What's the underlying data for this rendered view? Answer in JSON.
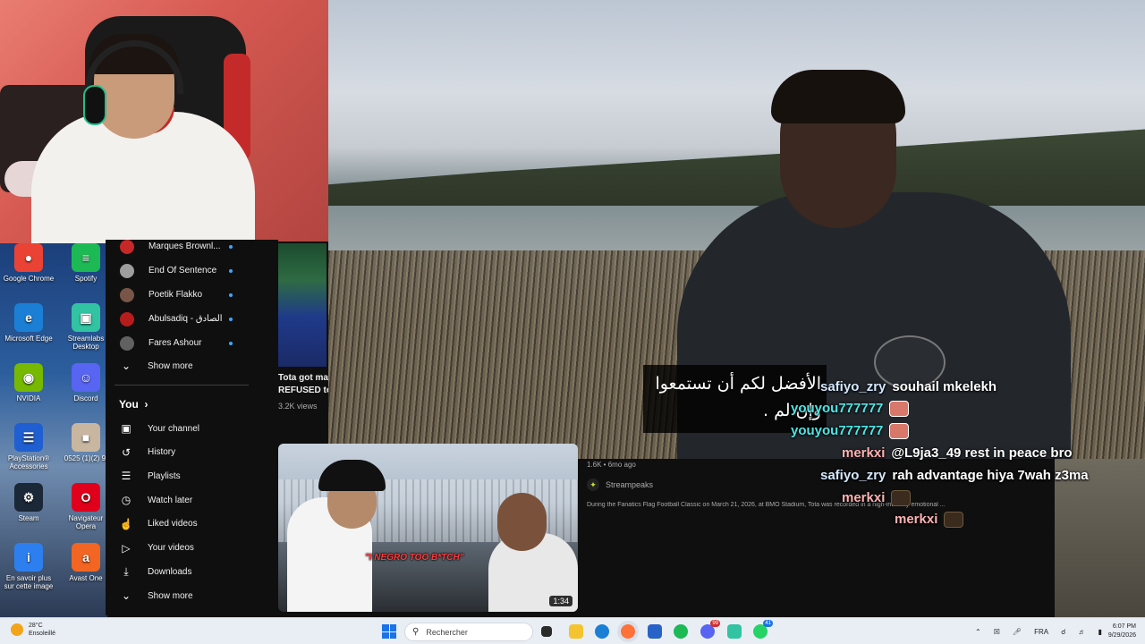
{
  "desktop": {
    "icons": [
      {
        "label": "Google Chrome",
        "color": "#ea4335",
        "glyph": "●"
      },
      {
        "label": "Spotify",
        "color": "#1db954",
        "glyph": "≡"
      },
      {
        "label": "Microsoft Edge",
        "color": "#1b7fd6",
        "glyph": "e"
      },
      {
        "label": "Streamlabs Desktop",
        "color": "#31c3a2",
        "glyph": "▣"
      },
      {
        "label": "NVIDIA",
        "color": "#76b900",
        "glyph": "◉"
      },
      {
        "label": "Discord",
        "color": "#5865f2",
        "glyph": "☺"
      },
      {
        "label": "PlayStation® Accessories",
        "color": "#1f5fd1",
        "glyph": "☰"
      },
      {
        "label": "0525 (1)(2) 9:",
        "color": "#c9b6a0",
        "glyph": "■"
      },
      {
        "label": "Steam",
        "color": "#1b2838",
        "glyph": "⚙"
      },
      {
        "label": "Navigateur Opera",
        "color": "#e0001b",
        "glyph": "O"
      },
      {
        "label": "En savoir plus sur cette image",
        "color": "#2d7ff0",
        "glyph": "i"
      },
      {
        "label": "Avast One",
        "color": "#f26522",
        "glyph": "a"
      }
    ]
  },
  "video": {
    "subtitle_line1": "الأفضل لكم أن تستمعوا",
    "subtitle_line2": "وإن لم ."
  },
  "chat": {
    "messages": [
      {
        "user": "safiyo_zry",
        "user_color": "#d4e8ff",
        "text": "souhail mkelekh",
        "emote": ""
      },
      {
        "user": "youyou777777",
        "user_color": "#4ee6e6",
        "text": "",
        "emote": "light"
      },
      {
        "user": "youyou777777",
        "user_color": "#4ee6e6",
        "text": "",
        "emote": "light"
      },
      {
        "user": "merkxi",
        "user_color": "#ffb3b3",
        "text": "@L9ja3_49 rest in peace bro",
        "emote": ""
      },
      {
        "user": "safiyo_zry",
        "user_color": "#d4e8ff",
        "text": "rah advantage hiya 7wah z3ma",
        "emote": ""
      },
      {
        "user": "merkxi",
        "user_color": "#ffb3b3",
        "text": "",
        "emote": "dark"
      },
      {
        "user": "merkxi",
        "user_color": "#ffb3b3",
        "text": "",
        "emote": "dark"
      }
    ]
  },
  "sidebar": {
    "subscriptions": [
      {
        "name": "Marques Brownl...",
        "avatar": "#c62828"
      },
      {
        "name": "End Of Sentence",
        "avatar": "#9e9e9e"
      },
      {
        "name": "Poetik Flakko",
        "avatar": "#795548"
      },
      {
        "name": "Abulsadiq - الصادق",
        "avatar": "#b71c1c"
      },
      {
        "name": "Fares Ashour",
        "avatar": "#616161"
      }
    ],
    "show_more_subs": "Show more",
    "you_label": "You",
    "you_chevron": "›",
    "you_items": [
      {
        "label": "Your channel",
        "icon": "user-box-icon",
        "glyph": "▣"
      },
      {
        "label": "History",
        "icon": "history-icon",
        "glyph": "↺"
      },
      {
        "label": "Playlists",
        "icon": "playlists-icon",
        "glyph": "☰"
      },
      {
        "label": "Watch later",
        "icon": "clock-icon",
        "glyph": "◷"
      },
      {
        "label": "Liked videos",
        "icon": "thumbs-up-icon",
        "glyph": "☝"
      },
      {
        "label": "Your videos",
        "icon": "play-box-icon",
        "glyph": "▷"
      },
      {
        "label": "Downloads",
        "icon": "download-icon",
        "glyph": "⤓"
      }
    ],
    "show_more_you": "Show more"
  },
  "feed": {
    "small_video_title_1": "Tota got ma",
    "small_video_title_2": "REFUSED to",
    "small_video_views": "3.2K views",
    "big_video_caption": "\"I NEGRO TOO B*TCH\"",
    "big_video_duration": "1:34",
    "meta": "1.6K • 6mo ago",
    "channel": "Streampeaks",
    "description": "During the Fanatics Flag Football Classic on March 21, 2026, at BMO Stadium, Tota was recorded in a high-intensity emotional ..."
  },
  "taskbar": {
    "temperature": "28°C",
    "weather": "Ensoleillé",
    "search_placeholder": "Rechercher",
    "badge_discord": "99",
    "badge_whatsapp": "41",
    "language": "FRA",
    "time": "6:07 PM",
    "date": "9/29/2026"
  }
}
